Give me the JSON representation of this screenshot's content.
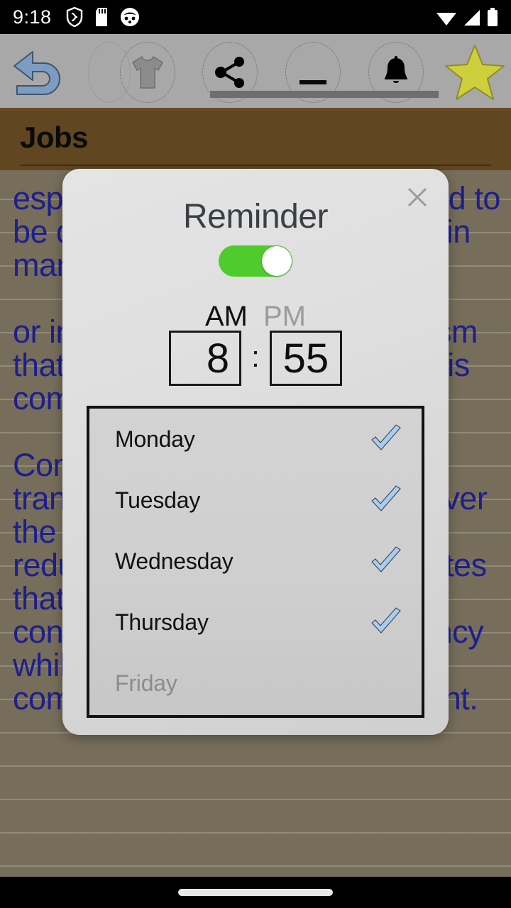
{
  "status_bar": {
    "clock": "9:18",
    "left_icons": [
      "shield-icon",
      "sd-card-icon",
      "cat-face-icon"
    ],
    "right_icons": [
      "wifi-icon",
      "cellular-signal-icon",
      "battery-icon"
    ]
  },
  "toolbar": {
    "items": [
      {
        "name": "back-arrow-icon",
        "label": "Back"
      },
      {
        "name": "shirt-icon",
        "label": "Clothing"
      },
      {
        "name": "share-icon",
        "label": "Share"
      },
      {
        "name": "minus-icon",
        "label": "Minus"
      },
      {
        "name": "bell-icon",
        "label": "Reminder"
      },
      {
        "name": "star-icon",
        "label": "Favorite"
      }
    ],
    "scrollbar": "horizontal-scrollbar"
  },
  "page": {
    "title": "Jobs",
    "body_text": "especially if the work is expected to be done quietly. They are used in many different settings\n\nor in cases where the mechanism that drives the whole assembly is compact.\n\nConsidering the size of the transmission, the extra space over the casing reduces the ability to reduce noise. This paper indicates that a reduction in power consumption and higher efficiency while keeping the mechanism compact is significantly important.",
    "text_color": "#22239c",
    "paper_color": "#847b65",
    "header_color": "#6d4f26"
  },
  "dialog": {
    "title": "Reminder",
    "close_icon": "close-icon",
    "enabled_toggle": {
      "name": "reminder-enabled-toggle",
      "state": "on",
      "on_color": "#4fcc2c"
    },
    "meridiem": {
      "options": [
        "AM",
        "PM"
      ],
      "selected": "AM"
    },
    "time": {
      "hour": "8",
      "separator": ":",
      "minute": "55"
    },
    "days": [
      {
        "label": "Monday",
        "checked": true,
        "faded": false
      },
      {
        "label": "Tuesday",
        "checked": true,
        "faded": false
      },
      {
        "label": "Wednesday",
        "checked": true,
        "faded": false
      },
      {
        "label": "Thursday",
        "checked": true,
        "faded": false
      },
      {
        "label": "Friday",
        "checked": false,
        "faded": true
      }
    ],
    "check_color": "#a8cdf0"
  },
  "nav_bar": {
    "pill": "home-gesture-pill"
  }
}
